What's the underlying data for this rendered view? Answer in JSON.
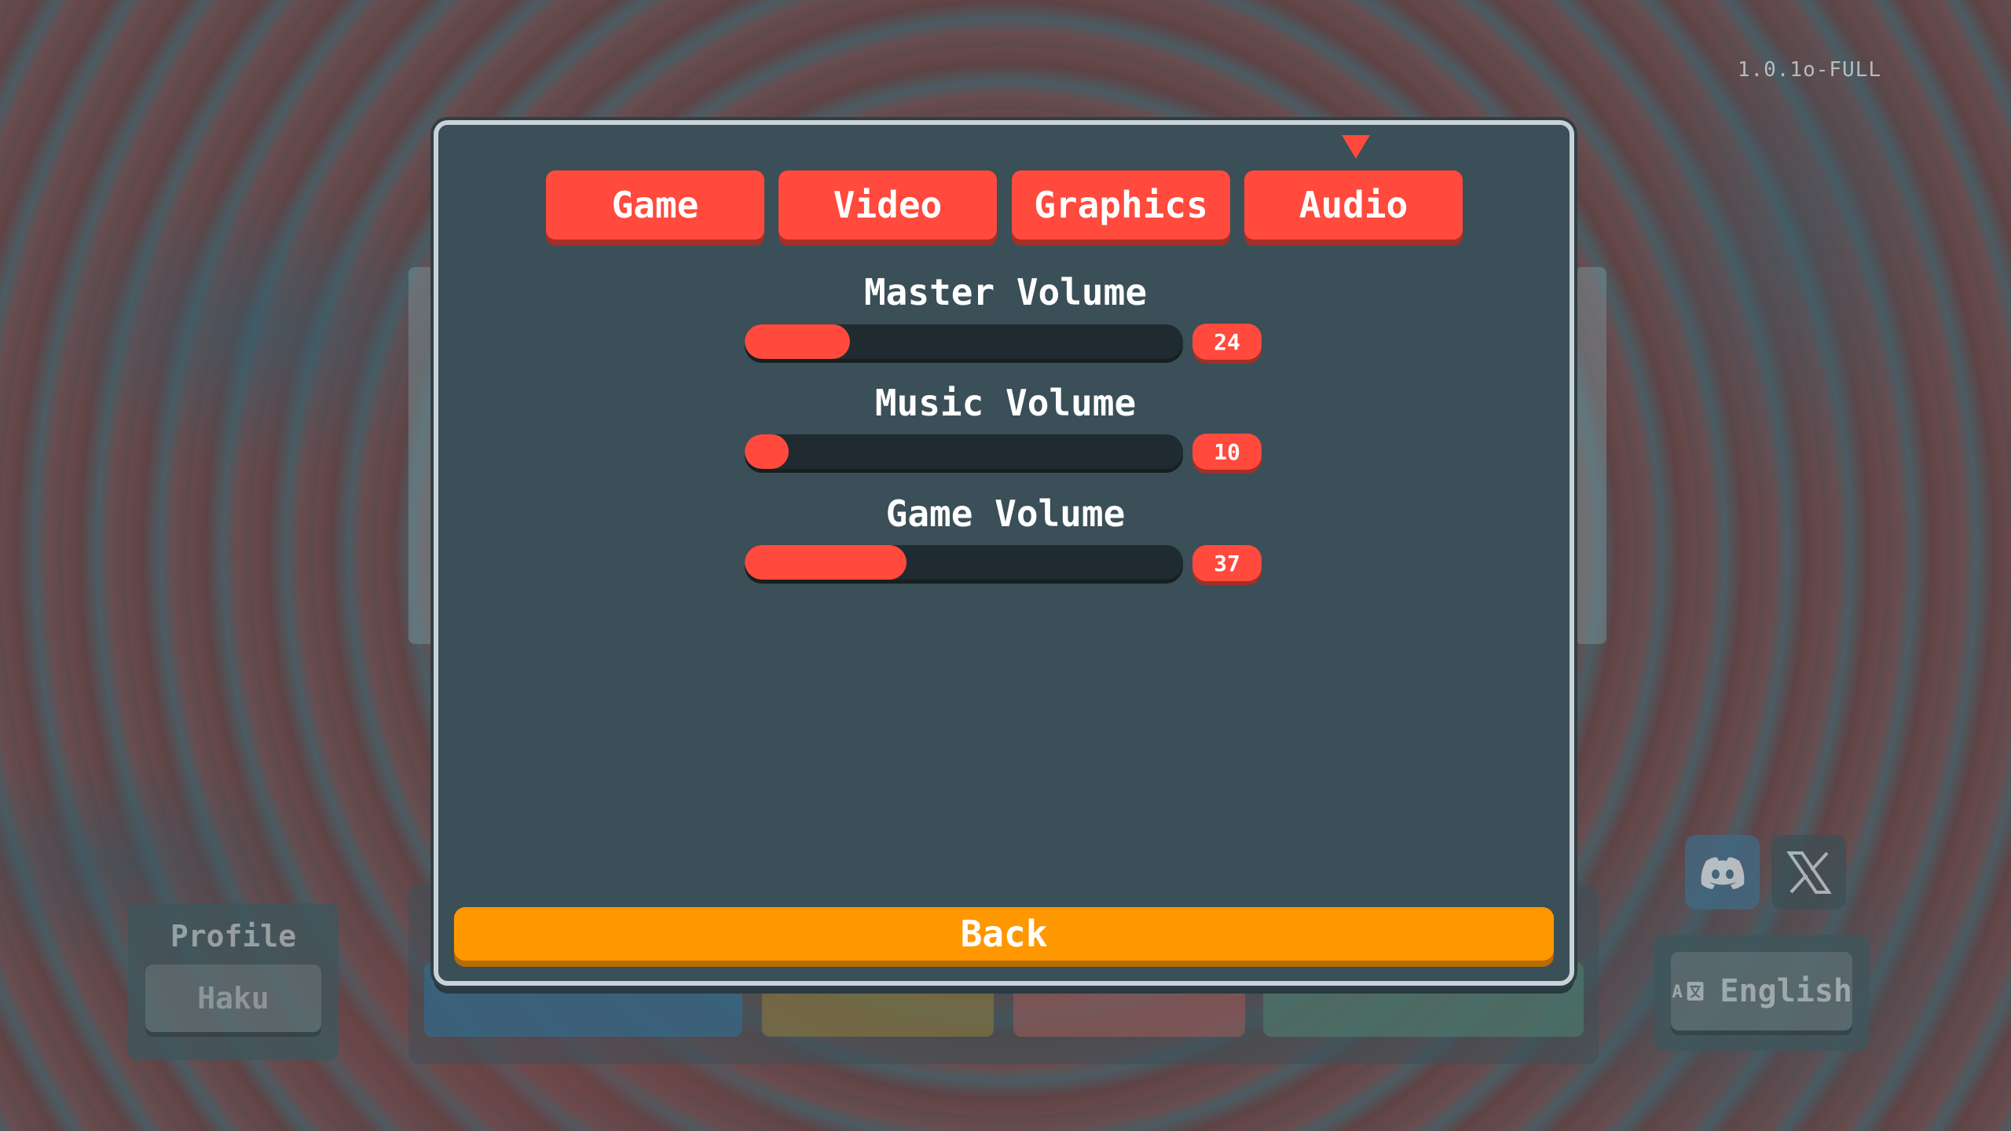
{
  "version": "1.0.1o-FULL",
  "tabs": [
    {
      "label": "Game"
    },
    {
      "label": "Video"
    },
    {
      "label": "Graphics"
    },
    {
      "label": "Audio"
    }
  ],
  "active_tab": "Audio",
  "sliders": [
    {
      "label": "Master Volume",
      "value": "24",
      "max": 100
    },
    {
      "label": "Music Volume",
      "value": "10",
      "max": 100
    },
    {
      "label": "Game Volume",
      "value": "37",
      "max": 100
    }
  ],
  "back_label": "Back",
  "profile": {
    "label": "Profile",
    "name": "Haku"
  },
  "language": {
    "label": "English"
  },
  "colors": {
    "accent": "#ff4a3d",
    "back": "#ff9800",
    "panel": "#3a4f57"
  }
}
